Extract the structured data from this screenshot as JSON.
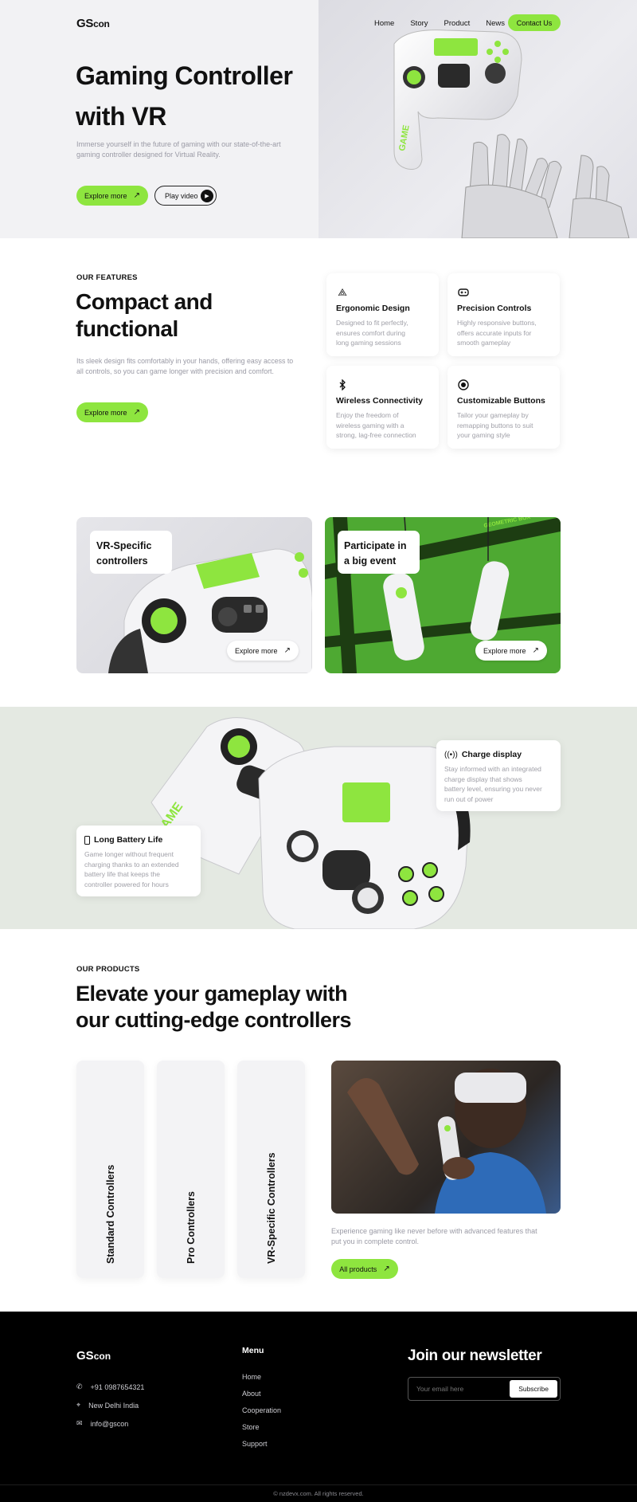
{
  "brand": {
    "logo_main": "GS",
    "logo_sub": "con"
  },
  "nav": {
    "items": [
      "Home",
      "Story",
      "Product",
      "News"
    ],
    "contact": "Contact Us"
  },
  "hero": {
    "title_line1": "Gaming Controller",
    "title_line2": "with VR",
    "desc_line1": "Immerse yourself in the future of gaming with our state-of-the-art",
    "desc_line2": "gaming controller designed for Virtual Reality.",
    "explore": "Explore more",
    "play": "Play video"
  },
  "features": {
    "eyebrow": "OUR FEATURES",
    "title_line1": "Compact and",
    "title_line2": "functional",
    "desc_line1": "Its sleek design fits comfortably in your hands, offering easy access to",
    "desc_line2": "all controls, so you can game longer with precision and comfort.",
    "explore": "Explore more",
    "cards": [
      {
        "title": "Ergonomic Design",
        "d1": "Designed to fit perfectly,",
        "d2": "ensures comfort during",
        "d3": "long gaming sessions",
        "icon": "shapes-icon"
      },
      {
        "title": "Precision Controls",
        "d1": "Highly responsive buttons,",
        "d2": "offers accurate inputs for",
        "d3": "smooth gameplay",
        "icon": "gamepad-icon"
      },
      {
        "title": "Wireless Connectivity",
        "d1": "Enjoy the freedom of",
        "d2": "wireless gaming with a",
        "d3": "strong, lag-free connection",
        "icon": "bluetooth-icon"
      },
      {
        "title": "Customizable Buttons",
        "d1": "Tailor your gameplay by",
        "d2": "remapping buttons to suit",
        "d3": "your gaming style",
        "icon": "radio-button-icon"
      }
    ]
  },
  "promo": {
    "left_line1": "VR-Specific",
    "left_line2": "controllers",
    "right_line1": "Participate in",
    "right_line2": "a big event",
    "explore": "Explore more"
  },
  "specs": {
    "charge": {
      "title": "Charge display",
      "d1": "Stay informed with an integrated",
      "d2": "charge display that shows",
      "d3": "battery level, ensuring you never",
      "d4": "run out of power"
    },
    "battery": {
      "title": "Long Battery Life",
      "d1": "Game longer without frequent",
      "d2": "charging thanks to an extended",
      "d3": "battery life that keeps the",
      "d4": "controller powered for hours"
    }
  },
  "products": {
    "eyebrow": "OUR PRODUCTS",
    "title_line1": "Elevate your gameplay with",
    "title_line2": "our cutting-edge controllers",
    "tabs": [
      "Standard Controllers",
      "Pro Controllers",
      "VR-Specific Controllers"
    ],
    "desc_line1": "Experience gaming like never before with advanced features that",
    "desc_line2": "put you in complete control.",
    "all": "All products"
  },
  "footer": {
    "phone": "+91 0987654321",
    "location": "New Delhi India",
    "email": "info@gscon",
    "menu_title": "Menu",
    "menu": [
      "Home",
      "About",
      "Cooperation",
      "Store",
      "Support"
    ],
    "newsletter": "Join our newsletter",
    "placeholder": "Your email here",
    "subscribe": "Subscribe",
    "copyright": "© nzdevx.com. All rights reserved."
  },
  "colors": {
    "accent": "#8ee53f",
    "dark": "#000000"
  }
}
